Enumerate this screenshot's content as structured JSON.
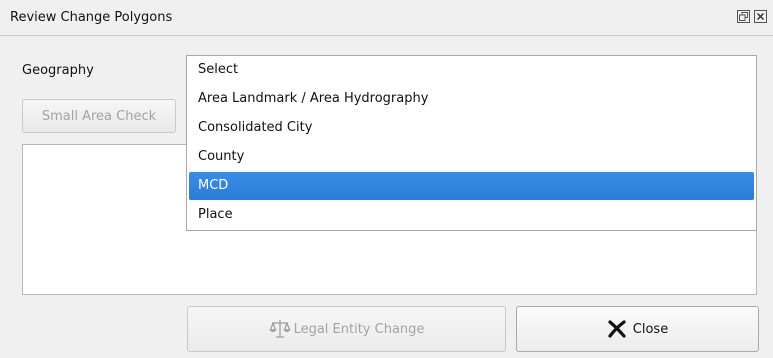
{
  "window": {
    "title": "Review Change Polygons"
  },
  "form": {
    "geography_label": "Geography",
    "small_area_check_label": "Small Area Check"
  },
  "dropdown": {
    "items": [
      "Select",
      "Area Landmark / Area Hydrography",
      "Consolidated City",
      "County",
      "MCD",
      "Place"
    ],
    "selected": "MCD"
  },
  "buttons": {
    "legal_entity_change_label": "Legal Entity Change",
    "close_label": "Close"
  },
  "icons": {
    "legal": "scales-icon",
    "close": "x-close-icon"
  },
  "colors": {
    "selection": "#2b7bd6",
    "disabled_text": "#a3a3a3"
  }
}
